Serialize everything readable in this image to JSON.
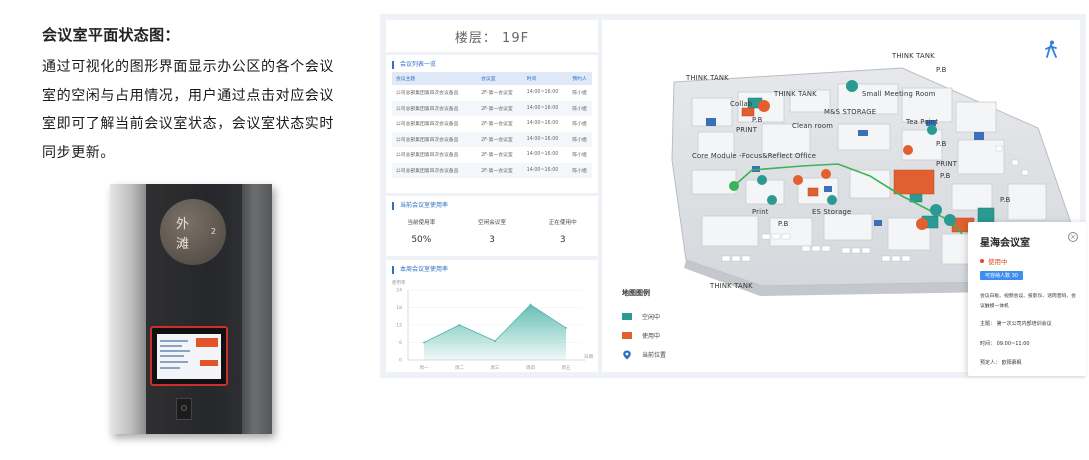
{
  "description": {
    "title": "会议室平面状态图：",
    "lines": [
      "通过可视化的图形界面显示办公区的各个会议",
      "室的空闲与占用情况，用户通过点击对应会议",
      "室即可了解当前会议室状态，会议室状态实时",
      "同步更新。"
    ]
  },
  "photo": {
    "plaque_chars": [
      "外",
      "滩"
    ],
    "plaque_number": "2"
  },
  "dashboard": {
    "floor": "楼层：  19F",
    "meeting_list": {
      "title": "会议列表一览",
      "headers": [
        "会议主题",
        "会议室",
        "时间",
        "预约人"
      ],
      "rows": [
        [
          "公司总部集团第四次会议备品",
          "2F-第一会议室",
          "14:00~16:00",
          "陈小姐"
        ],
        [
          "公司总部集团第四次会议备品",
          "2F-第一会议室",
          "14:00~16:00",
          "陈小姐"
        ],
        [
          "公司总部集团第四次会议备品",
          "2F-第一会议室",
          "14:00~16:00",
          "陈小姐"
        ],
        [
          "公司总部集团第四次会议备品",
          "2F-第一会议室",
          "14:00~16:00",
          "陈小姐"
        ],
        [
          "公司总部集团第四次会议备品",
          "2F-第一会议室",
          "14:00~16:00",
          "陈小姐"
        ],
        [
          "公司总部集团第四次会议备品",
          "2F-第一会议室",
          "14:00~16:00",
          "陈小姐"
        ]
      ]
    },
    "usage": {
      "title": "当前会议室使用率",
      "stats": [
        {
          "label": "当前使用率",
          "value": "50%"
        },
        {
          "label": "空闲会议室",
          "value": "3"
        },
        {
          "label": "正在使用中",
          "value": "3"
        }
      ]
    },
    "weekly": {
      "title": "本周会议室使用率",
      "ylabel": "使用率",
      "xlabel": "日期"
    },
    "map": {
      "labels": [
        "THINK TANK",
        "THINK TANK",
        "P.B",
        "Collab",
        "THINK TANK",
        "Small Meeting Room",
        "M&S STORAGE",
        "P.B",
        "PRINT",
        "Clean room",
        "Tea Point",
        "P.B",
        "Core Module -Focus&Reflect Office",
        "PRINT",
        "P.B",
        "Print",
        "ES Storage",
        "P.B",
        "P.B",
        "THINK TANK"
      ],
      "legend_title": "地图图例",
      "legend": [
        {
          "label": "空闲中",
          "color": "#2a9a92"
        },
        {
          "label": "使用中",
          "color": "#e2602f"
        },
        {
          "label": "当前位置",
          "color": "#2f6fc4"
        }
      ]
    },
    "detail": {
      "room": "星海会议室",
      "status": "使用中",
      "capacity": "可容纳人数 30",
      "devices": "会议白板、视频会议、投影仪、话筒音响、会议触摸一体机",
      "topic": "主题：  第一次公司内部培训会议",
      "time": "时间：  09:00~11:00",
      "booker": "预定人：  欧阳慕枫",
      "close": "×"
    }
  },
  "chart_data": {
    "type": "area",
    "title": "本周会议室使用率",
    "xlabel": "日期",
    "ylabel": "使用率",
    "categories": [
      "周一",
      "周二",
      "周三",
      "周四",
      "周五"
    ],
    "values": [
      6,
      12,
      6.5,
      19,
      11
    ],
    "ylim": [
      0,
      24
    ],
    "yticks": [
      0,
      6,
      12,
      18,
      24
    ],
    "color": "#4bb3a8"
  }
}
